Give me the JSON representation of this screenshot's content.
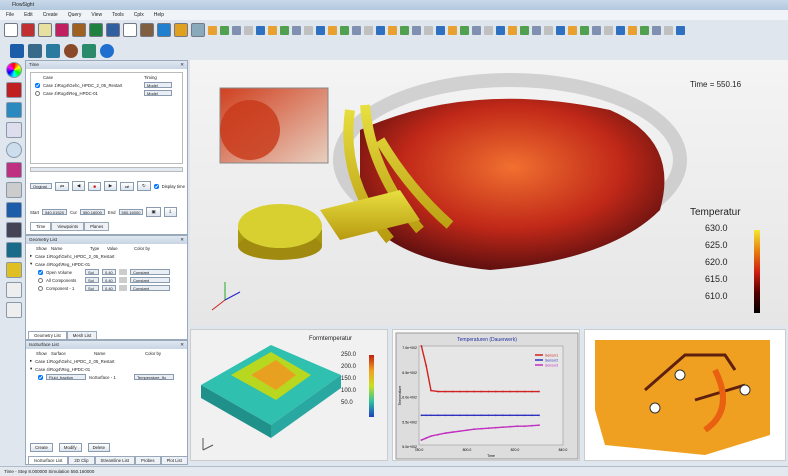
{
  "window": {
    "title": "FlowSight"
  },
  "menu": [
    "File",
    "Edit",
    "Create",
    "Query",
    "View",
    "Tools",
    "Cplx",
    "Help"
  ],
  "time_panel": {
    "title": "Time",
    "col_case": "Case",
    "col_timing": "Timing",
    "cases": [
      {
        "name": "Case 1\\Rog4\\Gehc_HPDC_2_05_Restart",
        "timing": "Model",
        "checked": true
      },
      {
        "name": "Case 4\\Rog4\\Reg_HPDC-01",
        "timing": "Model",
        "checked": false
      }
    ],
    "playback_mode": "Original",
    "display_time_label": "Display time",
    "start_label": "Start",
    "start_value": "540.01520",
    "cur_label": "Cur",
    "cur_value": "550.16000",
    "end_label": "End",
    "end_value": "550.16000",
    "tabs": [
      "Time",
      "Viewpoints",
      "Planes"
    ]
  },
  "geometry_panel": {
    "title": "Geometry List",
    "cols": [
      "Show",
      "Name",
      "Type",
      "Value",
      "Color by"
    ],
    "cases": [
      "Case 1\\Rog4\\Gehc_HPDC_2_05_Restart",
      "Case 4\\Rog4\\Reg_HPDC-01"
    ],
    "rows": [
      {
        "name": "Open Volume",
        "type": "Sol",
        "value": "0.40",
        "color": "Constant",
        "checked": true
      },
      {
        "name": "All Components",
        "type": "Sol",
        "value": "0.40",
        "color": "Constant",
        "checked": false
      },
      {
        "name": "Component - 1",
        "type": "Sol",
        "value": "0.40",
        "color": "Constant",
        "checked": false
      }
    ],
    "tabs": [
      "Geometry List",
      "Mesh List"
    ]
  },
  "iso_panel": {
    "title": "IsoSurface List",
    "cols": [
      "Show",
      "Surface",
      "Name",
      "Color by"
    ],
    "cases": [
      "Case 1\\Rog4\\Gehc_HPDC_2_05_Restart",
      "Case 4\\Rog4\\Reg_HPDC-01"
    ],
    "row": {
      "surface": "Fluid_fraction",
      "name": "IsoSurface - 1",
      "color": "Temperature_flu"
    },
    "buttons": [
      "Create",
      "Modify",
      "Delete"
    ],
    "tabs": [
      "IsoSurface List",
      "2D Clip",
      "Streamline List",
      "Probes",
      "Plot List"
    ]
  },
  "viewport": {
    "time_label": "Time = 550.16",
    "legend_title": "Temperatur",
    "legend_ticks": [
      "630.0",
      "625.0",
      "620.0",
      "615.0",
      "610.0"
    ]
  },
  "sub1": {
    "legend_title": "Formtemperatur",
    "legend_ticks": [
      "250.0",
      "200.0",
      "150.0",
      "100.0",
      "50.0"
    ]
  },
  "chart_data": {
    "type": "line",
    "title": "Temperaturen (Dauerwerk)",
    "xlabel": "Time",
    "ylabel": "Temperature",
    "x_ticks": [
      "780.0",
      "800.0",
      "820.0",
      "840.0"
    ],
    "y_ticks": [
      "7.0e+002",
      "6.5e+002",
      "6.0e+002",
      "5.5e+002",
      "5.0e+002"
    ],
    "xlim": [
      780,
      840
    ],
    "ylim": [
      500,
      700
    ],
    "x": [
      781,
      783,
      785,
      788,
      791,
      794,
      797,
      800,
      803,
      806,
      809,
      812,
      815,
      818,
      821,
      824,
      827,
      830
    ],
    "series": [
      {
        "name": "Sensor1",
        "color": "#d02020",
        "values": [
          700,
          660,
          610,
          608,
          608,
          608,
          608,
          608,
          608,
          608,
          608,
          608,
          608,
          608,
          608,
          608,
          608,
          608
        ]
      },
      {
        "name": "Sensor2",
        "color": "#3030c0",
        "values": [
          560,
          560,
          560,
          560,
          560,
          560,
          560,
          560,
          560,
          560,
          560,
          560,
          560,
          560,
          560,
          560,
          560,
          560
        ]
      },
      {
        "name": "Sensor3",
        "color": "#c030c0",
        "values": [
          510,
          514,
          518,
          521,
          524,
          526,
          528,
          530,
          532,
          533,
          534,
          535,
          536,
          537,
          538,
          538,
          539,
          540
        ]
      }
    ]
  },
  "status": {
    "text": "Time - Step 8.000000 Simulation 550.160000"
  },
  "colors": {
    "accent": "#1f6fb2"
  }
}
